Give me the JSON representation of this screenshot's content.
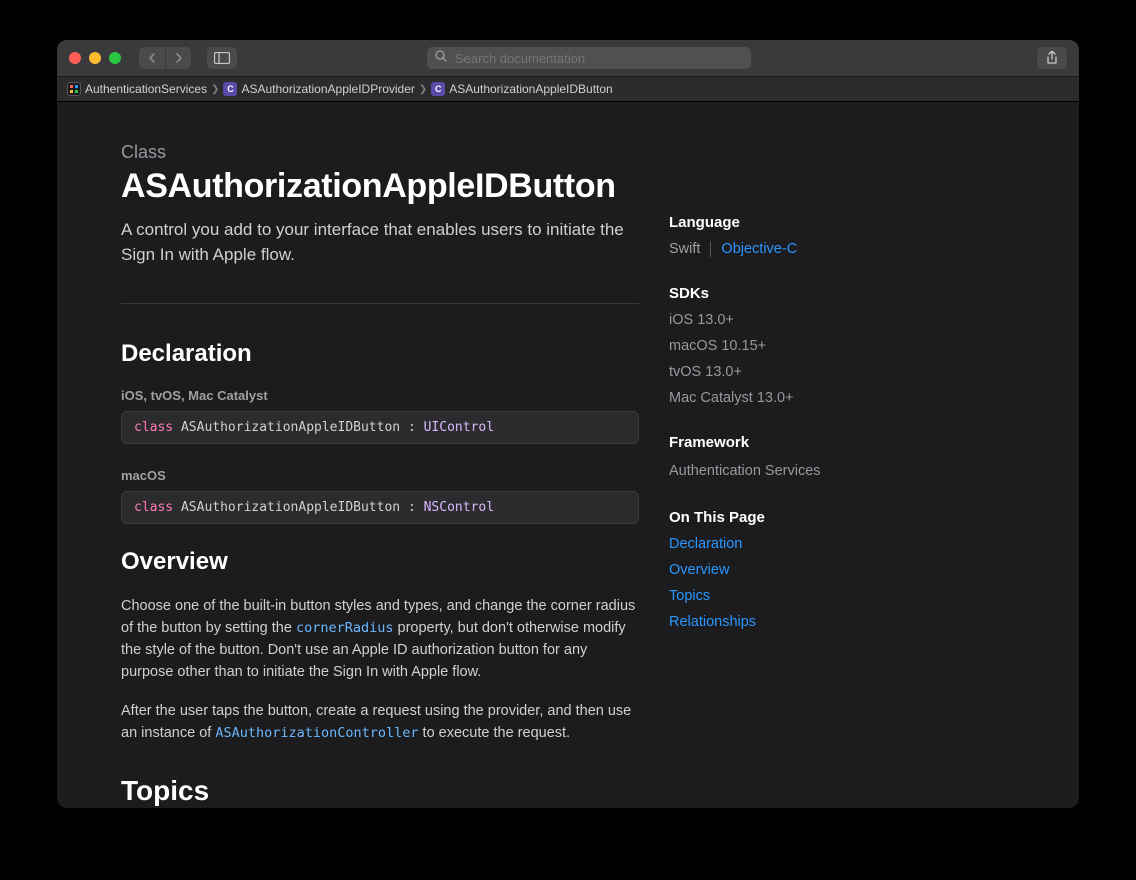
{
  "search": {
    "placeholder": "Search documentation"
  },
  "breadcrumbs": [
    {
      "label": "AuthenticationServices"
    },
    {
      "label": "ASAuthorizationAppleIDProvider"
    },
    {
      "label": "ASAuthorizationAppleIDButton"
    }
  ],
  "page": {
    "eyebrow": "Class",
    "title": "ASAuthorizationAppleIDButton",
    "description": "A control you add to your interface that enables users to initiate the Sign In with Apple flow."
  },
  "sections": {
    "declaration": "Declaration",
    "overview": "Overview",
    "topics": "Topics"
  },
  "declarations": [
    {
      "platform": "iOS, tvOS, Mac Catalyst",
      "keyword": "class",
      "name": "ASAuthorizationAppleIDButton",
      "colon": " : ",
      "supertype": "UIControl"
    },
    {
      "platform": "macOS",
      "keyword": "class",
      "name": "ASAuthorizationAppleIDButton",
      "colon": " : ",
      "supertype": "NSControl"
    }
  ],
  "overview": {
    "p1a": "Choose one of the built-in button styles and types, and change the corner radius of the button by setting the ",
    "p1_code": "cornerRadius",
    "p1b": " property, but don't otherwise modify the style of the button. Don't use an Apple ID authorization button for any purpose other than to initiate the Sign In with Apple flow.",
    "p2a": "After the user taps the button, create a request using the provider, and then use an instance of ",
    "p2_code": "ASAuthorizationController",
    "p2b": " to execute the request."
  },
  "sidebar": {
    "language_label": "Language",
    "lang_swift": "Swift",
    "lang_objc": "Objective-C",
    "sdks_label": "SDKs",
    "sdks": [
      "iOS 13.0+",
      "macOS 10.15+",
      "tvOS 13.0+",
      "Mac Catalyst 13.0+"
    ],
    "framework_label": "Framework",
    "framework": "Authentication Services",
    "otp_label": "On This Page",
    "otp": [
      "Declaration",
      "Overview",
      "Topics",
      "Relationships"
    ]
  }
}
